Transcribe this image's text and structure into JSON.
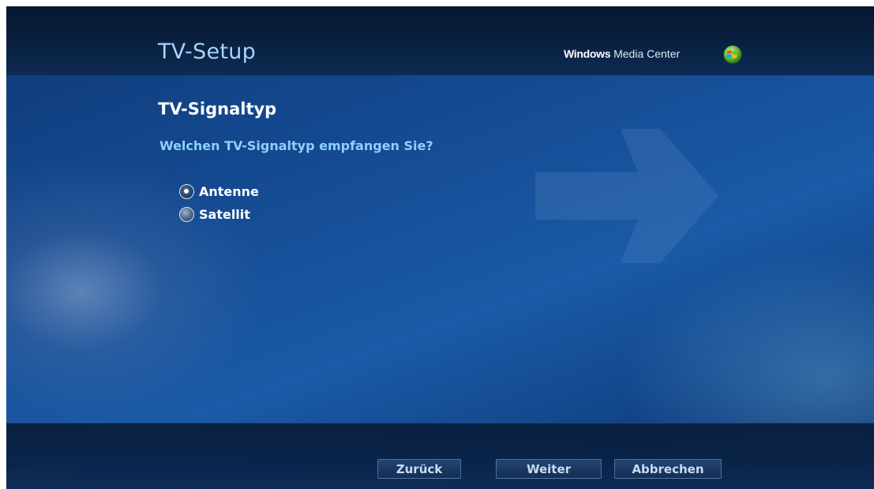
{
  "header": {
    "title": "TV-Setup",
    "brand_bold": "Windows",
    "brand_light": " Media Center"
  },
  "main": {
    "heading": "TV-Signaltyp",
    "question": "Welchen TV-Signaltyp empfangen Sie?",
    "options": [
      {
        "label": "Antenne",
        "selected": true
      },
      {
        "label": "Satellit",
        "selected": false
      }
    ]
  },
  "footer": {
    "back_label": "Zurück",
    "next_label": "Weiter",
    "cancel_label": "Abbrechen"
  },
  "icons": {
    "brand_logo": "windows-logo-icon",
    "decoration": "arrow-right-icon"
  }
}
